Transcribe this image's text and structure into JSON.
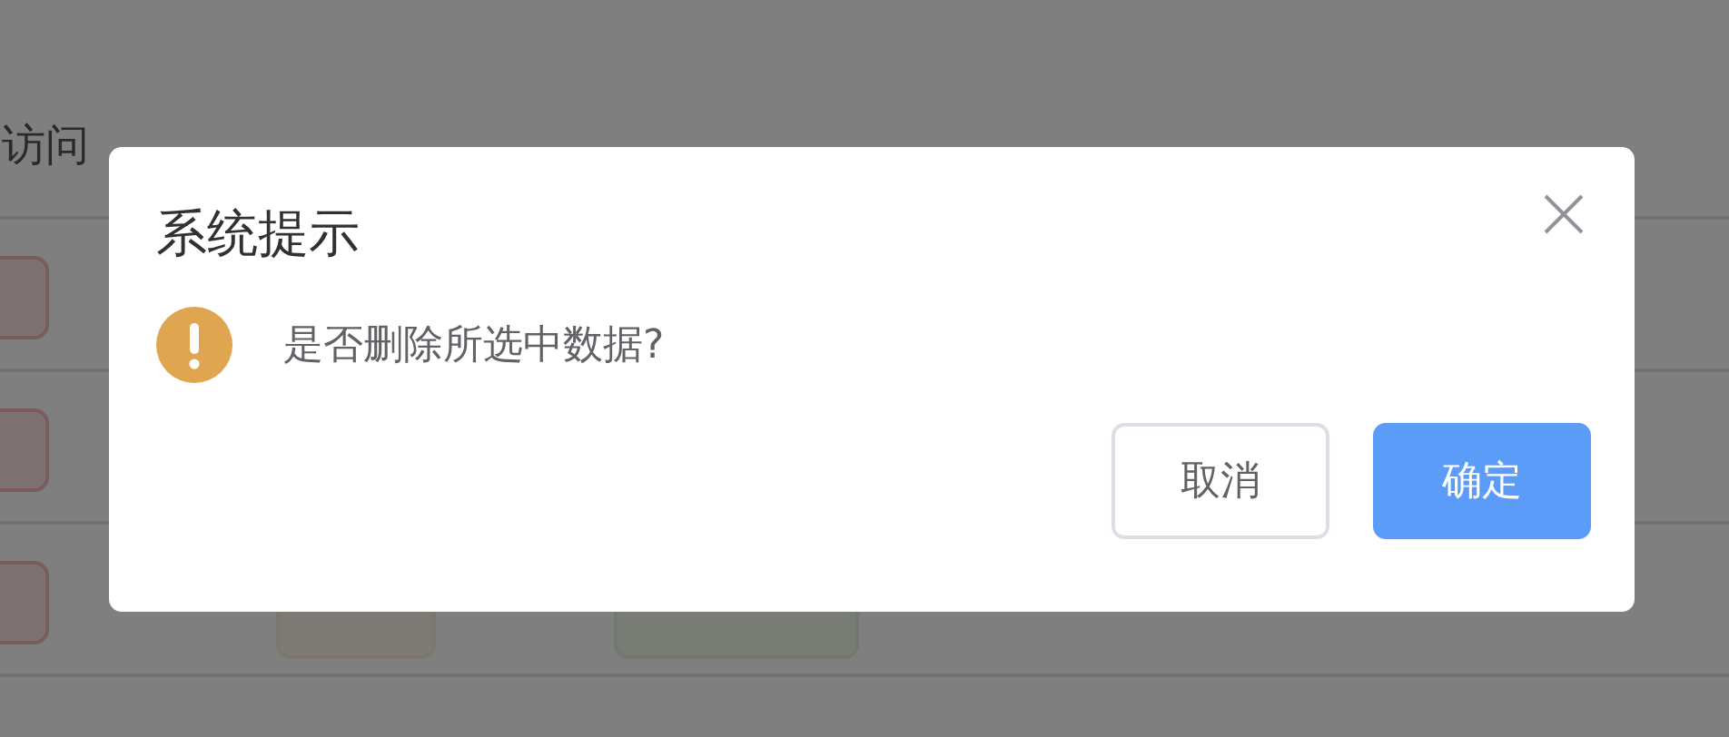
{
  "table": {
    "header": {
      "column_1": "访问"
    }
  },
  "dialog": {
    "title": "系统提示",
    "message": "是否删除所选中数据?",
    "buttons": [
      {
        "label": "取消",
        "kind": "secondary"
      },
      {
        "label": "确定",
        "kind": "primary"
      }
    ]
  }
}
